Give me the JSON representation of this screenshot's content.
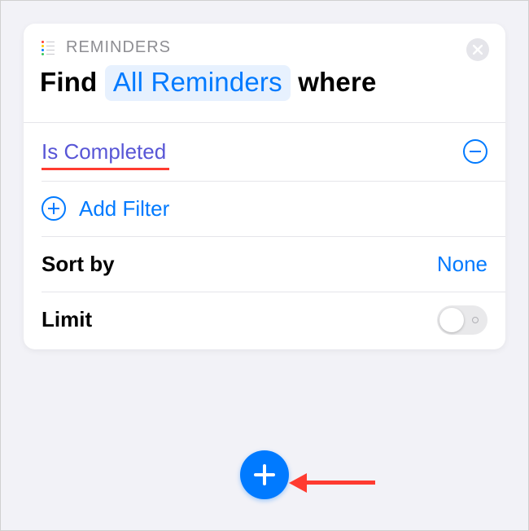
{
  "header": {
    "app_name": "REMINDERS"
  },
  "query": {
    "find_label": "Find",
    "source_token": "All Reminders",
    "where_label": "where"
  },
  "filters": [
    {
      "label": "Is Completed"
    }
  ],
  "add_filter_label": "Add Filter",
  "sort": {
    "label": "Sort by",
    "value": "None"
  },
  "limit": {
    "label": "Limit",
    "enabled": false
  }
}
